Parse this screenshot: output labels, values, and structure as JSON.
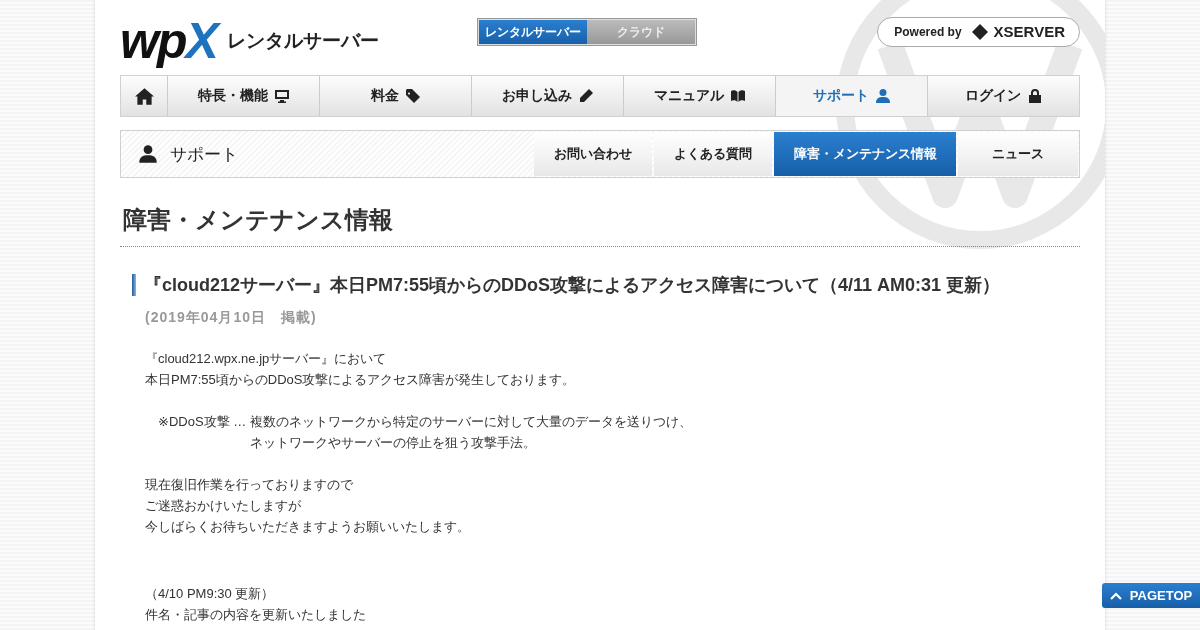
{
  "header": {
    "logo": {
      "wp": "wp",
      "x": "X"
    },
    "tagline": "レンタルサーバー",
    "service_tabs": [
      {
        "label": "レンタルサーバー",
        "selected": true
      },
      {
        "label": "クラウド",
        "selected": false
      }
    ],
    "powered_by": {
      "label": "Powered by",
      "brand": "XSERVER"
    }
  },
  "main_nav": [
    {
      "kind": "home",
      "selected": false
    },
    {
      "kind": "monitor",
      "label": "特長・機能",
      "selected": false
    },
    {
      "kind": "tag",
      "label": "料金",
      "selected": false
    },
    {
      "kind": "pencil",
      "label": "お申し込み",
      "selected": false
    },
    {
      "kind": "book",
      "label": "マニュアル",
      "selected": false
    },
    {
      "kind": "person",
      "label": "サポート",
      "selected": true
    },
    {
      "kind": "lock",
      "label": "ログイン",
      "selected": false
    }
  ],
  "sub_nav": {
    "title": "サポート",
    "items": [
      {
        "label": "お問い合わせ",
        "selected": false
      },
      {
        "label": "よくある質問",
        "selected": false
      },
      {
        "label": "障害・メンテナンス情報",
        "selected": true
      },
      {
        "label": "ニュース",
        "selected": false
      }
    ]
  },
  "page_title": "障害・メンテナンス情報",
  "article": {
    "title": "『cloud212サーバー』本日PM7:55頃からのDDoS攻撃によるアクセス障害について（4/11 AM0:31 更新）",
    "date": "(2019年04月10日　掲載)",
    "body": [
      {
        "kind": "text",
        "lines": [
          "『cloud212.wpx.ne.jpサーバー』において",
          "本日PM7:55頃からのDDoS攻撃によるアクセス障害が発生しております。"
        ]
      },
      {
        "kind": "note",
        "label": "※DDoS攻撃 …",
        "lines": [
          "複数のネットワークから特定のサーバーに対して大量のデータを送りつけ、",
          "ネットワークやサーバーの停止を狙う攻撃手法。"
        ]
      },
      {
        "kind": "text",
        "lines": [
          "現在復旧作業を行っておりますので",
          "ご迷惑おかけいたしますが",
          "今しばらくお待ちいただきますようお願いいたします。"
        ]
      },
      {
        "kind": "update",
        "lines": [
          "（4/10 PM9:30 更新）",
          "件名・記事の内容を更新いたしました"
        ]
      }
    ]
  },
  "pagetop": "PAGETOP"
}
